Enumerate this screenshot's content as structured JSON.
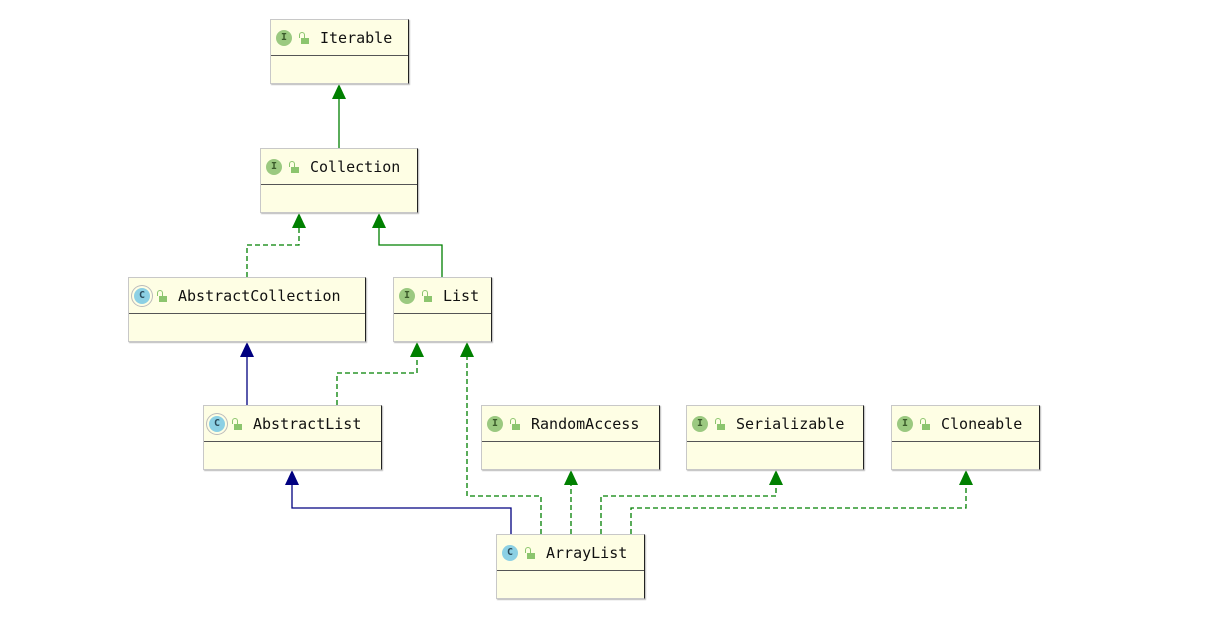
{
  "colors": {
    "implements": "#008000",
    "extends_interface": "#008000",
    "extends_class": "#000080",
    "node_fill": "#fefee4"
  },
  "nodes": [
    {
      "id": "Iterable",
      "label": "Iterable",
      "kind": "interface",
      "icon": "I"
    },
    {
      "id": "Collection",
      "label": "Collection",
      "kind": "interface",
      "icon": "I"
    },
    {
      "id": "AbstractCollection",
      "label": "AbstractCollection",
      "kind": "abstract-class",
      "icon": "C"
    },
    {
      "id": "List",
      "label": "List",
      "kind": "interface",
      "icon": "I"
    },
    {
      "id": "AbstractList",
      "label": "AbstractList",
      "kind": "abstract-class",
      "icon": "C"
    },
    {
      "id": "RandomAccess",
      "label": "RandomAccess",
      "kind": "interface",
      "icon": "I"
    },
    {
      "id": "Serializable",
      "label": "Serializable",
      "kind": "interface",
      "icon": "I"
    },
    {
      "id": "Cloneable",
      "label": "Cloneable",
      "kind": "interface",
      "icon": "I"
    },
    {
      "id": "ArrayList",
      "label": "ArrayList",
      "kind": "class",
      "icon": "C"
    }
  ],
  "edges": [
    {
      "from": "Collection",
      "to": "Iterable",
      "type": "extends-interface"
    },
    {
      "from": "AbstractCollection",
      "to": "Collection",
      "type": "implements"
    },
    {
      "from": "List",
      "to": "Collection",
      "type": "extends-interface"
    },
    {
      "from": "AbstractList",
      "to": "AbstractCollection",
      "type": "extends-class"
    },
    {
      "from": "AbstractList",
      "to": "List",
      "type": "implements"
    },
    {
      "from": "ArrayList",
      "to": "AbstractList",
      "type": "extends-class"
    },
    {
      "from": "ArrayList",
      "to": "List",
      "type": "implements"
    },
    {
      "from": "ArrayList",
      "to": "RandomAccess",
      "type": "implements"
    },
    {
      "from": "ArrayList",
      "to": "Serializable",
      "type": "implements"
    },
    {
      "from": "ArrayList",
      "to": "Cloneable",
      "type": "implements"
    }
  ]
}
